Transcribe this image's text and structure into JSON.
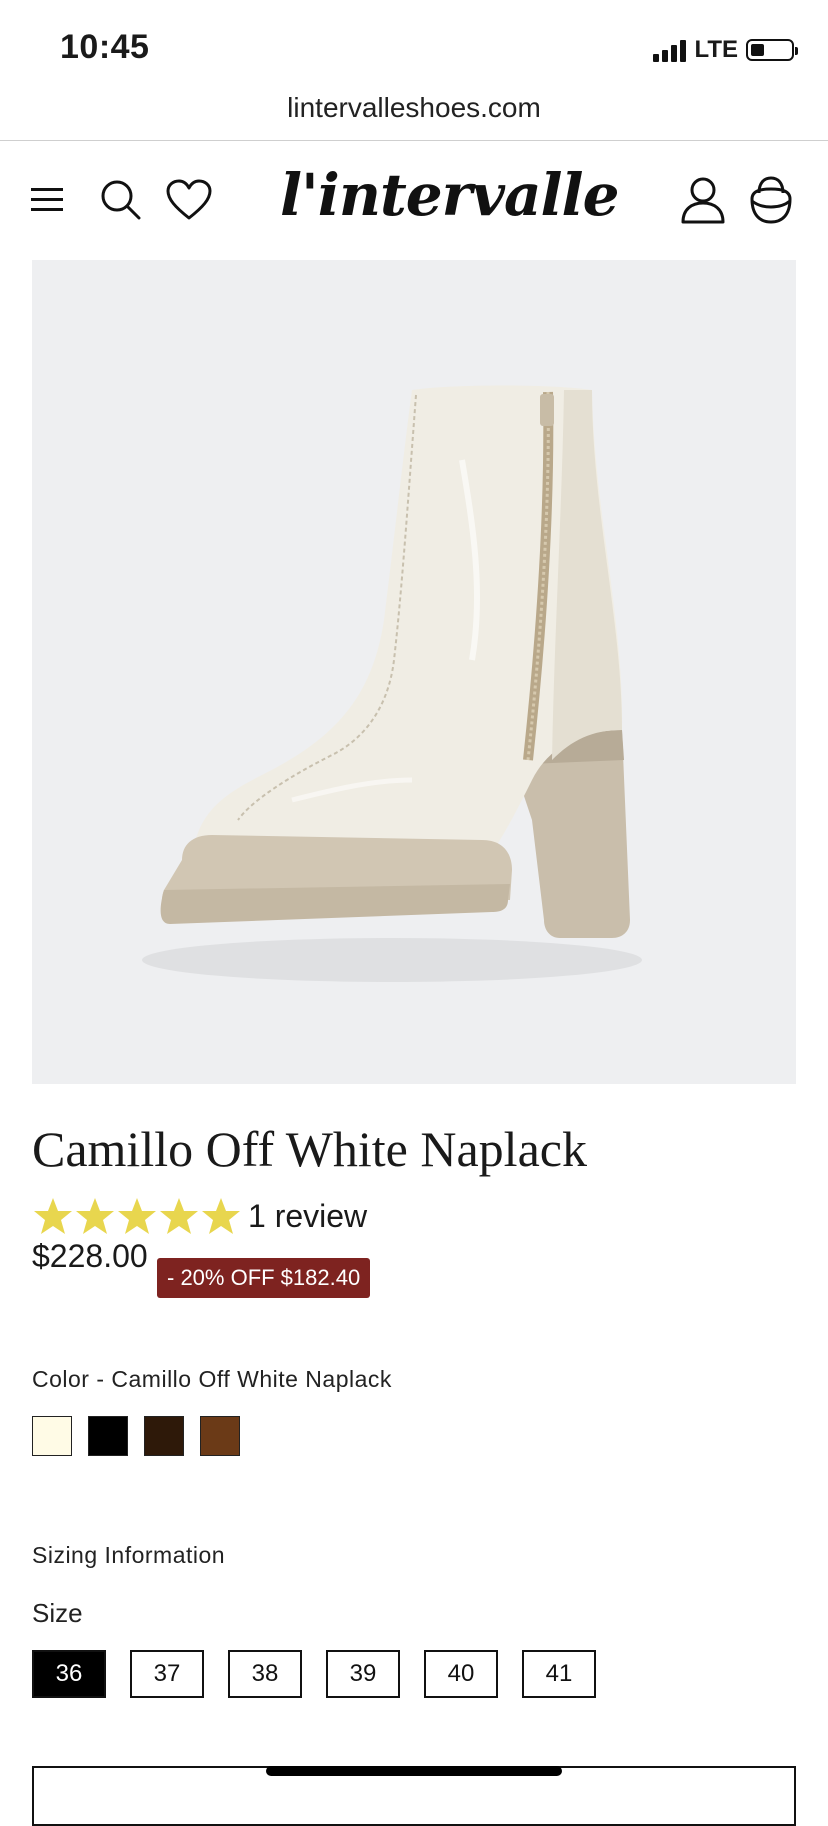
{
  "status_bar": {
    "time": "10:45",
    "network": "LTE",
    "battery_level": 0.25
  },
  "browser": {
    "url": "lintervalleshoes.com"
  },
  "header": {
    "logo_text": "l'intervalle",
    "icons": [
      "menu-icon",
      "search-icon",
      "heart-icon",
      "account-icon",
      "cart-icon"
    ]
  },
  "product": {
    "title": "Camillo Off White Naplack",
    "rating": 5,
    "review_text": "1 review",
    "price": "$228.00",
    "discount_text": "- 20% OFF $182.40",
    "color_label": "Color - Camillo Off White Naplack",
    "swatches": [
      {
        "name": "off-white",
        "color": "#fffbe6"
      },
      {
        "name": "black",
        "color": "#000000"
      },
      {
        "name": "dark-brown",
        "color": "#2e1909"
      },
      {
        "name": "brown",
        "color": "#6b3a17"
      }
    ],
    "sizing_info": "Sizing Information",
    "size_label": "Size",
    "sizes": [
      "36",
      "37",
      "38",
      "39",
      "40",
      "41"
    ],
    "selected_size": "36"
  },
  "colors": {
    "star": "#e8d64e",
    "badge": "#7e2320",
    "image_bg": "#eeeff1"
  }
}
